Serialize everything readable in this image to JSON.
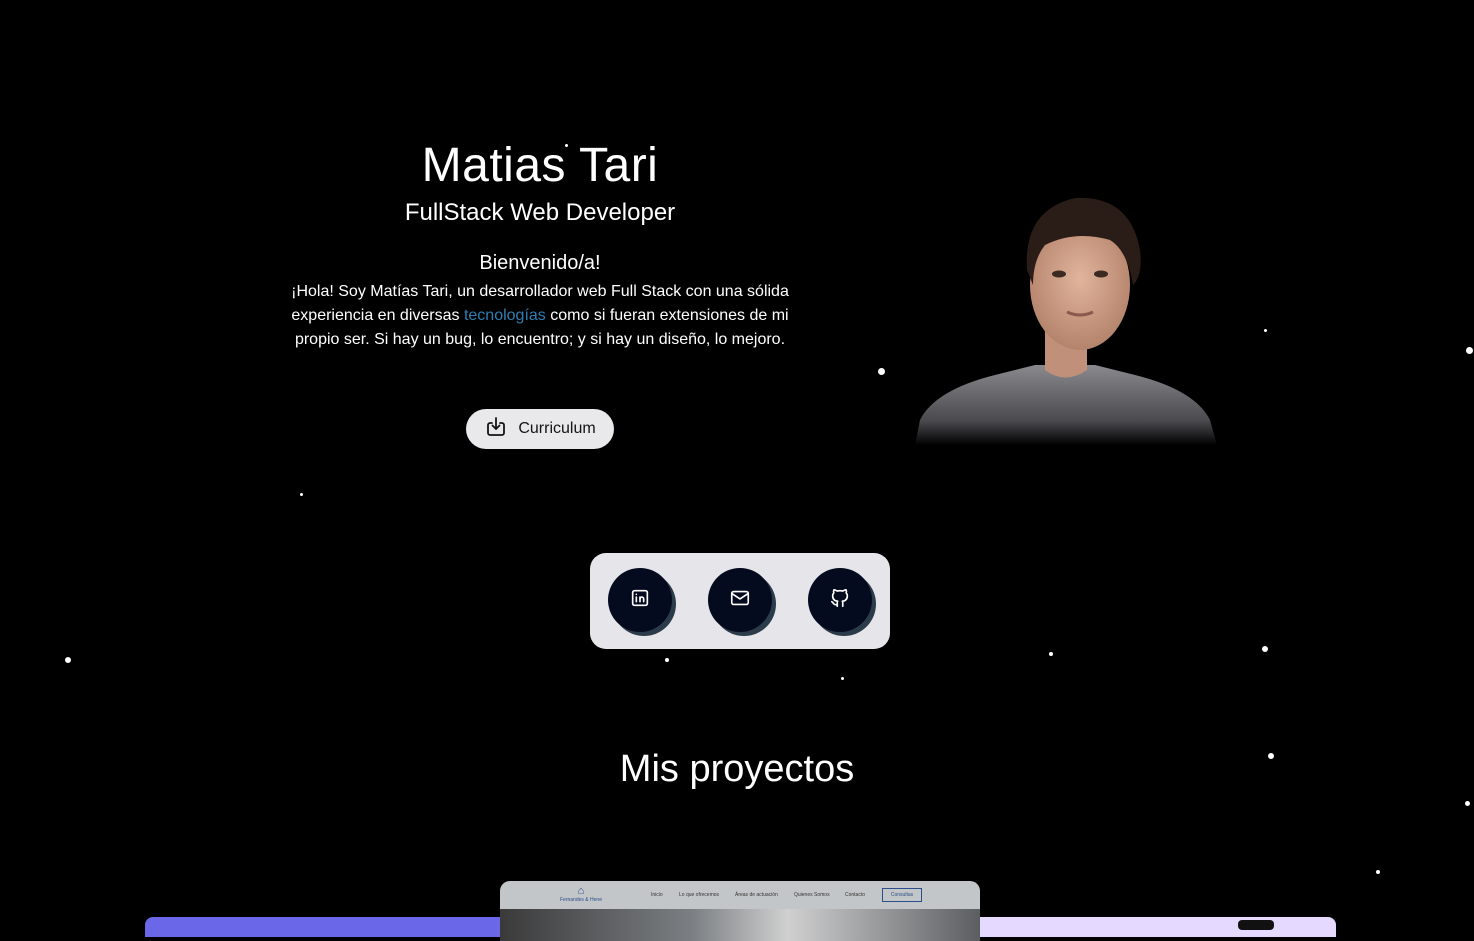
{
  "hero": {
    "name": "Matias Tari",
    "role": "FullStack Web Developer",
    "welcome": "Bienvenido/a!",
    "bio_before": "¡Hola! Soy Matías Tari, un desarrollador web Full Stack con una sólida experiencia en diversas ",
    "bio_link": "tecnologías",
    "bio_after": " como si fueran extensiones de mi propio ser. Si hay un bug, lo encuentro; y si hay un diseño, lo mejoro.",
    "cv_button": "Curriculum"
  },
  "social": [
    {
      "name": "linkedin",
      "icon": "linkedin-icon"
    },
    {
      "name": "email",
      "icon": "mail-icon"
    },
    {
      "name": "github",
      "icon": "github-icon"
    }
  ],
  "projects": {
    "title": "Mis proyectos",
    "preview": {
      "logo_text": "Fernandes & Hene",
      "nav": [
        "Inicio",
        "Lo que ofrecemos",
        "Áreas de actuación",
        "Quienes Somos",
        "Contacto"
      ],
      "cta": "Consultas"
    }
  },
  "colors": {
    "background": "#000000",
    "link": "#2f7fb3",
    "button_bg": "#e9e9ec",
    "social_circle": "#050b1f",
    "card_left": "#6a67e8",
    "card_right": "#e6d9ff"
  }
}
